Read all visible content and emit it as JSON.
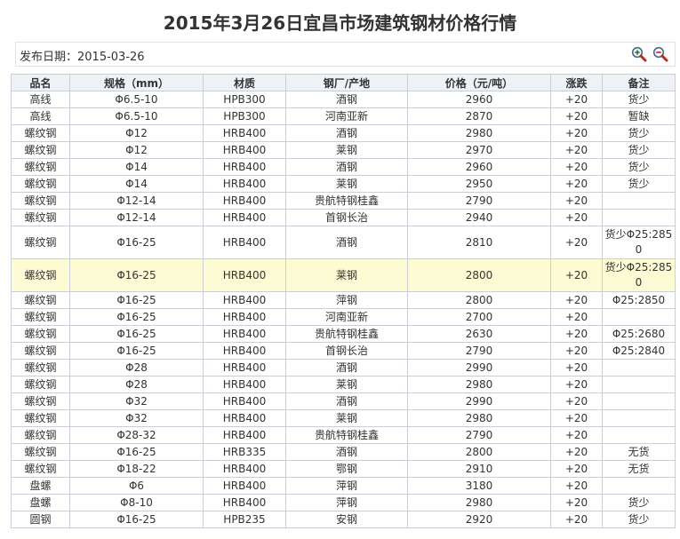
{
  "page": {
    "title": "2015年3月26日宜昌市场建筑钢材价格行情",
    "publish_label": "发布日期：2015-03-26"
  },
  "icons": {
    "zoom_in": "zoom-in-icon",
    "zoom_out": "zoom-out-icon"
  },
  "colors": {
    "header_bg": "#eef1f6",
    "highlight_row": "#fdfbd3",
    "border": "#c9ced8"
  },
  "table": {
    "headers": [
      "品名",
      "规格（mm）",
      "材质",
      "钢厂/产地",
      "价格（元/吨）",
      "涨跌",
      "备注"
    ],
    "rows": [
      [
        "高线",
        "Φ6.5-10",
        "HPB300",
        "酒钢",
        "2960",
        "+20",
        "货少"
      ],
      [
        "高线",
        "Φ6.5-10",
        "HPB300",
        "河南亚新",
        "2870",
        "+20",
        "暂缺"
      ],
      [
        "螺纹钢",
        "Φ12",
        "HRB400",
        "酒钢",
        "2980",
        "+20",
        "货少"
      ],
      [
        "螺纹钢",
        "Φ12",
        "HRB400",
        "莱钢",
        "2970",
        "+20",
        "货少"
      ],
      [
        "螺纹钢",
        "Φ14",
        "HRB400",
        "酒钢",
        "2960",
        "+20",
        "货少"
      ],
      [
        "螺纹钢",
        "Φ14",
        "HRB400",
        "莱钢",
        "2950",
        "+20",
        "货少"
      ],
      [
        "螺纹钢",
        "Φ12-14",
        "HRB400",
        "贵航特钢桂鑫",
        "2790",
        "+20",
        ""
      ],
      [
        "螺纹钢",
        "Φ12-14",
        "HRB400",
        "首钢长治",
        "2940",
        "+20",
        ""
      ],
      [
        "螺纹钢",
        "Φ16-25",
        "HRB400",
        "酒钢",
        "2810",
        "+20",
        "货少Φ25:2850"
      ],
      [
        "螺纹钢",
        "Φ16-25",
        "HRB400",
        "莱钢",
        "2800",
        "+20",
        "货少Φ25:2850"
      ],
      [
        "螺纹钢",
        "Φ16-25",
        "HRB400",
        "萍钢",
        "2800",
        "+20",
        "Φ25:2850"
      ],
      [
        "螺纹钢",
        "Φ16-25",
        "HRB400",
        "河南亚新",
        "2700",
        "+20",
        ""
      ],
      [
        "螺纹钢",
        "Φ16-25",
        "HRB400",
        "贵航特钢桂鑫",
        "2630",
        "+20",
        "Φ25:2680"
      ],
      [
        "螺纹钢",
        "Φ16-25",
        "HRB400",
        "首钢长治",
        "2790",
        "+20",
        "Φ25:2840"
      ],
      [
        "螺纹钢",
        "Φ28",
        "HRB400",
        "酒钢",
        "2990",
        "+20",
        ""
      ],
      [
        "螺纹钢",
        "Φ28",
        "HRB400",
        "莱钢",
        "2980",
        "+20",
        ""
      ],
      [
        "螺纹钢",
        "Φ32",
        "HRB400",
        "酒钢",
        "2990",
        "+20",
        ""
      ],
      [
        "螺纹钢",
        "Φ32",
        "HRB400",
        "莱钢",
        "2980",
        "+20",
        ""
      ],
      [
        "螺纹钢",
        "Φ28-32",
        "HRB400",
        "贵航特钢桂鑫",
        "2790",
        "+20",
        ""
      ],
      [
        "螺纹钢",
        "Φ16-25",
        "HRB335",
        "酒钢",
        "2800",
        "+20",
        "无货"
      ],
      [
        "螺纹钢",
        "Φ18-22",
        "HRB400",
        "鄂钢",
        "2910",
        "+20",
        "无货"
      ],
      [
        "盘螺",
        "Φ6",
        "HRB400",
        "萍钢",
        "3180",
        "+20",
        ""
      ],
      [
        "盘螺",
        "Φ8-10",
        "HRB400",
        "萍钢",
        "2980",
        "+20",
        "货少"
      ],
      [
        "圆钢",
        "Φ16-25",
        "HPB235",
        "安钢",
        "2920",
        "+20",
        "货少"
      ]
    ]
  }
}
